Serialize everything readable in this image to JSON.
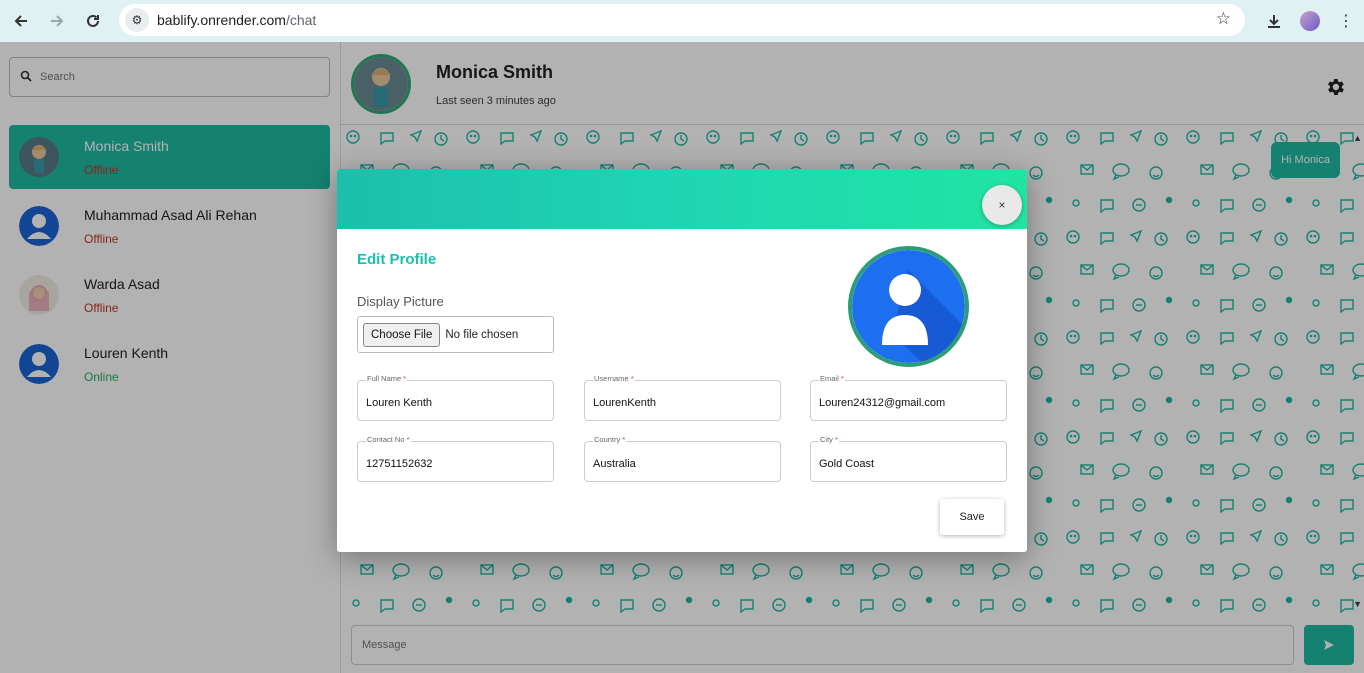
{
  "browser": {
    "url_domain": "bablify.onrender.com",
    "url_path": "/chat"
  },
  "sidebar": {
    "search_placeholder": "Search",
    "contacts": [
      {
        "name": "Monica Smith",
        "status": "Offline"
      },
      {
        "name": "Muhammad Asad Ali Rehan",
        "status": "Offline"
      },
      {
        "name": "Warda Asad",
        "status": "Offline"
      },
      {
        "name": "Louren Kenth",
        "status": "Online"
      }
    ]
  },
  "chat": {
    "contact_name": "Monica Smith",
    "last_seen": "Last seen 3 minutes ago",
    "messages": [
      {
        "text": "Hi Monica",
        "sent": true
      }
    ],
    "message_placeholder": "Message"
  },
  "modal": {
    "close_label": "×",
    "title": "Edit Profile",
    "display_picture_label": "Display Picture",
    "choose_file_label": "Choose File",
    "no_file_text": "No file chosen",
    "fields": {
      "full_name": {
        "label": "Full Name",
        "value": "Louren Kenth"
      },
      "username": {
        "label": "Username",
        "value": "LourenKenth"
      },
      "email": {
        "label": "Email",
        "value": "Louren24312@gmail.com"
      },
      "contact_no": {
        "label": "Contact No",
        "value": "12751152632"
      },
      "country": {
        "label": "Country",
        "value": "Australia"
      },
      "city": {
        "label": "City",
        "value": "Gold Coast"
      }
    },
    "required_marker": "*",
    "save_label": "Save"
  },
  "colors": {
    "accent": "#1fb9a3",
    "offline": "#c0392b",
    "online": "#27ae60",
    "modal_title": "#1cbfab"
  }
}
